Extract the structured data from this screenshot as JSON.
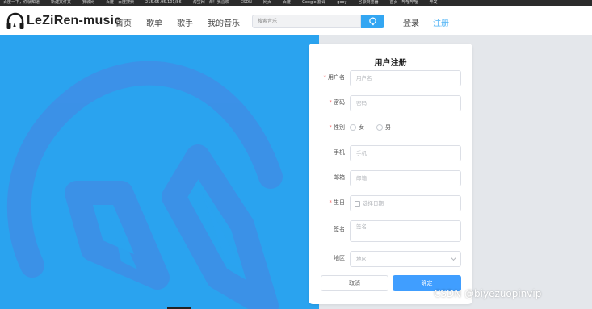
{
  "browser": {
    "bookmarks": [
      "百度一下，你就知道",
      "新建文件夹",
      "狮城网",
      "百度 - 百度搜索",
      "215.65.95.101/86",
      "淘宝网 - 淘！我喜欢",
      "CSDN",
      "网页",
      "百度",
      "Google 翻译",
      "gooy",
      "谷歌浏览器",
      "首页 - 哔哩哔哩",
      "开发"
    ]
  },
  "header": {
    "logo_text": "LeZiRen-music",
    "nav": [
      "首页",
      "歌单",
      "歌手",
      "我的音乐"
    ],
    "search_placeholder": "搜索音乐",
    "login": "登录",
    "register": "注册"
  },
  "form": {
    "title": "用户注册",
    "username_label": "用户名",
    "username_placeholder": "用户名",
    "password_label": "密码",
    "password_placeholder": "密码",
    "gender_label": "性别",
    "gender_female": "女",
    "gender_male": "男",
    "phone_label": "手机",
    "phone_placeholder": "手机",
    "email_label": "邮箱",
    "email_placeholder": "邮箱",
    "birthday_label": "生日",
    "birthday_placeholder": "选择日期",
    "signature_label": "签名",
    "signature_placeholder": "签名",
    "region_label": "地区",
    "region_placeholder": "地区",
    "cancel": "取消",
    "confirm": "确定",
    "required_mark": "*"
  },
  "watermark": "CSDN @biyezuopinvip",
  "colors": {
    "hero_blue": "#2aa3ef",
    "primary_button": "#409eff",
    "search_button": "#33a6f2",
    "register_link": "#4fb3f5",
    "required_mark": "#f56c6c"
  },
  "icons": {
    "logo": "headphones-icon",
    "search": "search-icon",
    "birthday": "calendar-icon",
    "region": "chevron-down-icon"
  }
}
